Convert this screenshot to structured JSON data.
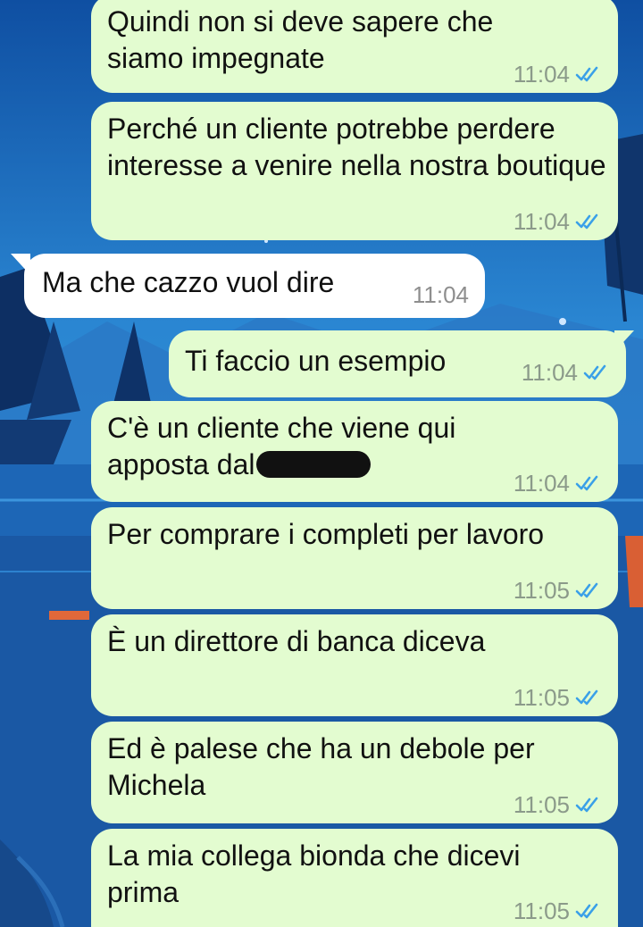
{
  "chat": {
    "messages": [
      {
        "direction": "out",
        "text": "Quindi non si deve sapere che siamo impegnate",
        "time": "11:04",
        "status": "read-double-check-icon"
      },
      {
        "direction": "out",
        "text": "Perché un cliente potrebbe perdere interesse a venire nella nostra boutique",
        "time": "11:04",
        "status": "read-double-check-icon"
      },
      {
        "direction": "in",
        "text": "Ma che cazzo vuol dire",
        "time": "11:04"
      },
      {
        "direction": "out",
        "text": "Ti faccio un esempio",
        "time": "11:04",
        "status": "read-double-check-icon"
      },
      {
        "direction": "out",
        "text": "C'è un cliente che viene qui apposta dal",
        "redacted": true,
        "time": "11:04",
        "status": "read-double-check-icon"
      },
      {
        "direction": "out",
        "text": "Per comprare i completi per lavoro",
        "time": "11:05",
        "status": "read-double-check-icon"
      },
      {
        "direction": "out",
        "text": "È un direttore di banca diceva",
        "time": "11:05",
        "status": "read-double-check-icon"
      },
      {
        "direction": "out",
        "text": "Ed è palese che ha un debole per Michela",
        "time": "11:05",
        "status": "read-double-check-icon"
      },
      {
        "direction": "out",
        "text": "La mia collega bionda che dicevi prima",
        "time": "11:05",
        "status": "read-double-check-icon"
      }
    ]
  },
  "colors": {
    "outgoing_bubble": "#e3fcd0",
    "incoming_bubble": "#ffffff",
    "read_ticks": "#3aa0e8",
    "wallpaper_sky": "#1f6fc0",
    "wallpaper_water": "#1a5aa6"
  }
}
